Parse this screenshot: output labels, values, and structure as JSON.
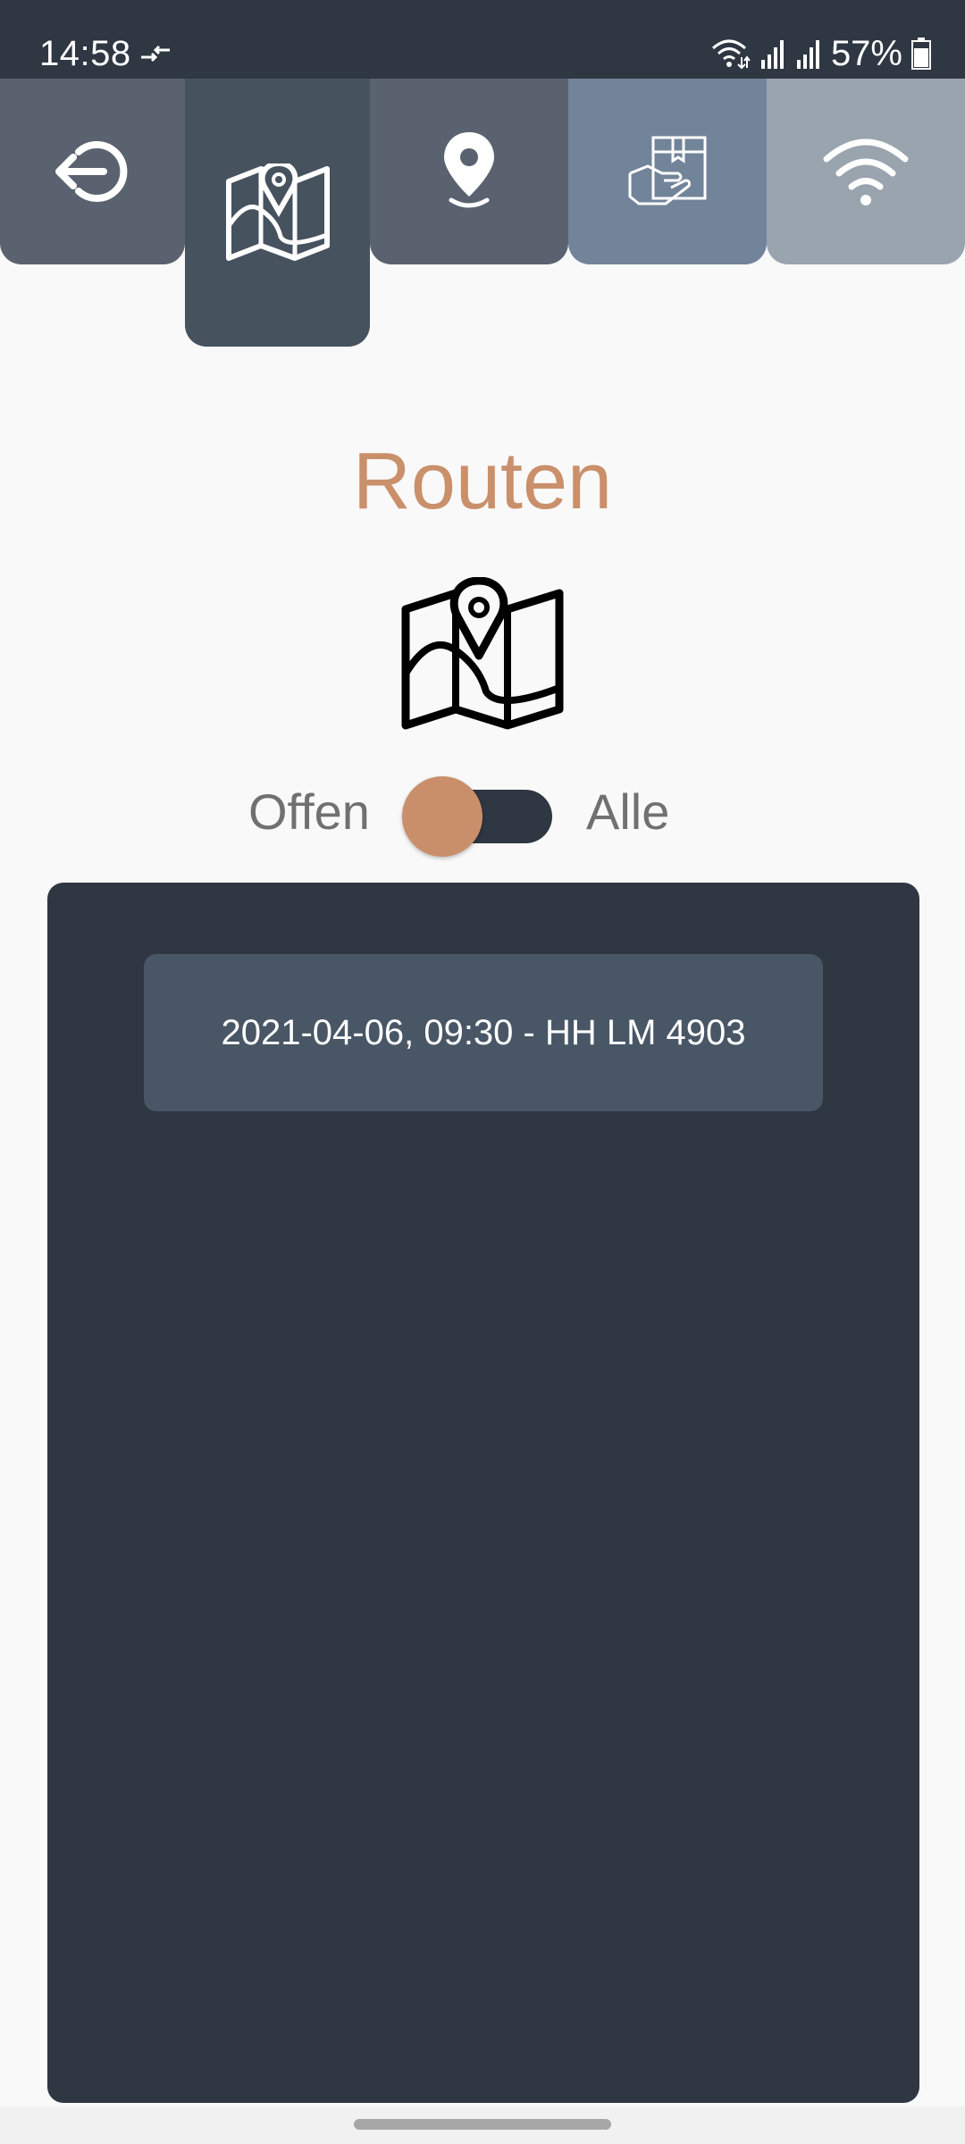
{
  "status_bar": {
    "time": "14:58",
    "battery": "57%",
    "icons": [
      "data-transfer-icon",
      "wifi-calling-icon",
      "signal-icon",
      "signal-icon",
      "battery-icon"
    ]
  },
  "nav": {
    "tabs": [
      {
        "name": "logout",
        "icon": "logout-icon",
        "color": "#59626e"
      },
      {
        "name": "routes",
        "icon": "map-icon",
        "color": "#47525f",
        "active": true
      },
      {
        "name": "location",
        "icon": "location-pin-icon",
        "color": "#59626e"
      },
      {
        "name": "delivery",
        "icon": "package-delivery-icon",
        "color": "#72849a"
      },
      {
        "name": "wifi",
        "icon": "wifi-icon",
        "color": "#9aa4af"
      }
    ]
  },
  "page": {
    "title": "Routen",
    "title_color": "#c9906b",
    "hero_icon": "map-icon"
  },
  "filter": {
    "left_label": "Offen",
    "right_label": "Alle",
    "selected": "Offen",
    "knob_color": "#c98f6a",
    "track_color": "#2e3742"
  },
  "routes": {
    "items": [
      {
        "label": "2021-04-06, 09:30 - HH LM 4903"
      }
    ]
  }
}
